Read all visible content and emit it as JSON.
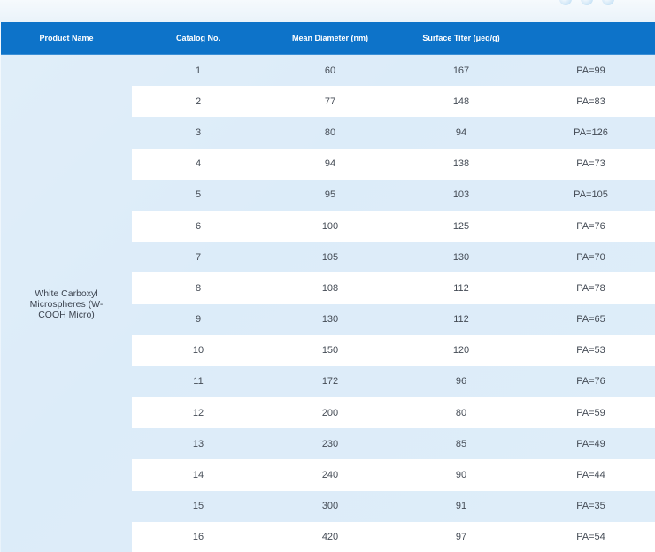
{
  "table": {
    "headers": [
      "Product Name",
      "Catalog No.",
      "Mean Diameter (nm)",
      "Surface Titer (μeq/g)",
      ""
    ],
    "product_name": "White Carboxyl Microspheres (W-COOH Micro)",
    "rows": [
      [
        "1",
        "60",
        "167",
        "PA=99"
      ],
      [
        "2",
        "77",
        "148",
        "PA=83"
      ],
      [
        "3",
        "80",
        "94",
        "PA=126"
      ],
      [
        "4",
        "94",
        "138",
        "PA=73"
      ],
      [
        "5",
        "95",
        "103",
        "PA=105"
      ],
      [
        "6",
        "100",
        "125",
        "PA=76"
      ],
      [
        "7",
        "105",
        "130",
        "PA=70"
      ],
      [
        "8",
        "108",
        "112",
        "PA=78"
      ],
      [
        "9",
        "130",
        "112",
        "PA=65"
      ],
      [
        "10",
        "150",
        "120",
        "PA=53"
      ],
      [
        "11",
        "172",
        "96",
        "PA=76"
      ],
      [
        "12",
        "200",
        "80",
        "PA=59"
      ],
      [
        "13",
        "230",
        "85",
        "PA=49"
      ],
      [
        "14",
        "240",
        "90",
        "PA=44"
      ],
      [
        "15",
        "300",
        "91",
        "PA=35"
      ],
      [
        "16",
        "420",
        "97",
        "PA=54"
      ]
    ]
  },
  "colors": {
    "header_bg": "#0d73c9",
    "row_tint": "#d6e8f7",
    "text": "#444b55"
  }
}
